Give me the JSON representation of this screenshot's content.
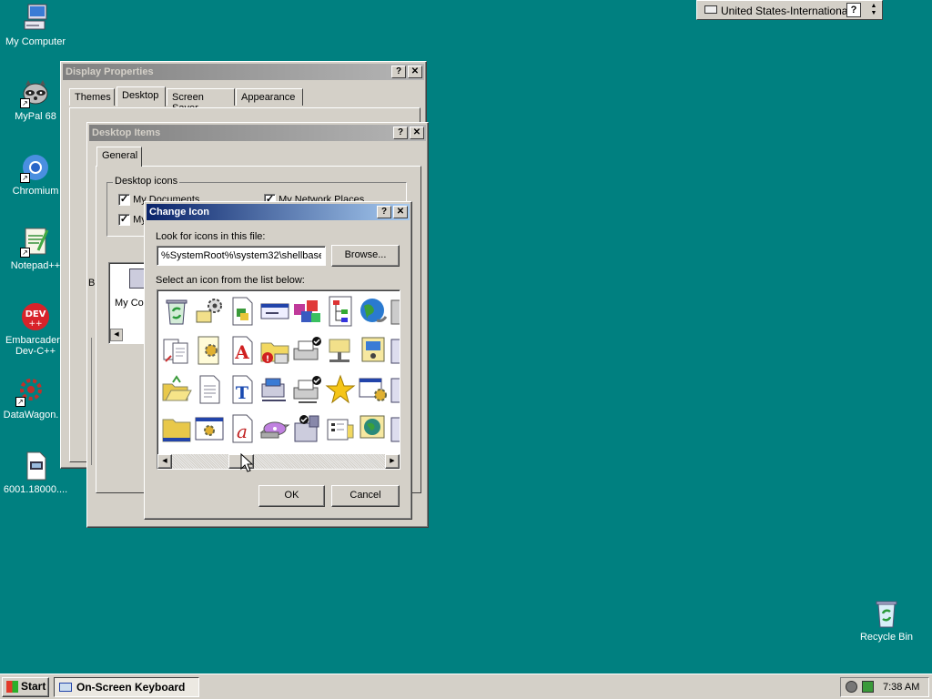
{
  "desktop": {
    "icons": [
      {
        "label": "My Computer"
      },
      {
        "label": "MyPal 68"
      },
      {
        "label": "Chromium"
      },
      {
        "label": "Notepad++"
      },
      {
        "label": "Embarcadero Dev-C++"
      },
      {
        "label": "DataWagon."
      },
      {
        "label": "6001.18000...."
      },
      {
        "label": "Recycle Bin"
      }
    ]
  },
  "language_bar": {
    "language": "United States-International",
    "help": "?"
  },
  "display_properties": {
    "title": "Display Properties",
    "tabs": [
      {
        "label": "Themes"
      },
      {
        "label": "Desktop"
      },
      {
        "label": "Screen Saver"
      },
      {
        "label": "Appearance"
      }
    ]
  },
  "desktop_items": {
    "title": "Desktop Items",
    "tab": "General",
    "group_label": "Desktop icons",
    "checkboxes": [
      {
        "label": "My Documents"
      },
      {
        "label": "My Network Places"
      },
      {
        "label": "My"
      }
    ],
    "preview_label": "My Com",
    "side_letter": "B"
  },
  "change_icon": {
    "title": "Change Icon",
    "file_label": "Look for icons in this file:",
    "file_value": "%SystemRoot%\\system32\\shellbase",
    "browse": "Browse...",
    "list_label": "Select an icon from the list below:",
    "ok": "OK",
    "cancel": "Cancel",
    "scroll_left": "◀",
    "scroll_right": "▶"
  },
  "taskbar": {
    "start": "Start",
    "task": "On-Screen Keyboard",
    "clock": "7:38 AM"
  },
  "colors": {
    "desktop": "#008080",
    "title_active": "#0a246a",
    "window": "#d4d0c8"
  }
}
